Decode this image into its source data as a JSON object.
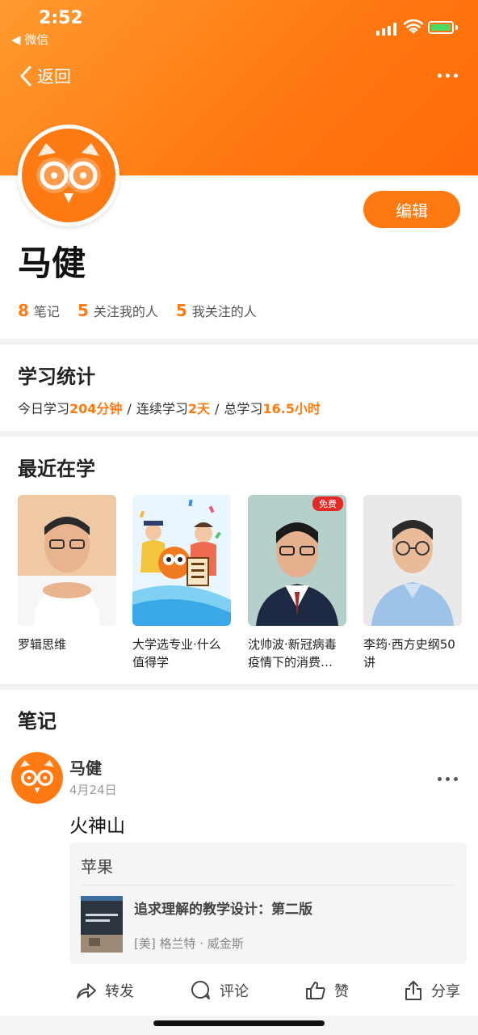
{
  "status_bar": {
    "time": "2:52",
    "back_app": "◀ 微信"
  },
  "nav": {
    "back_label": "返回"
  },
  "profile": {
    "name": "马健",
    "edit_label": "编辑",
    "stats": [
      {
        "num": "8",
        "label": "笔记"
      },
      {
        "num": "5",
        "label": "关注我的人"
      },
      {
        "num": "5",
        "label": "我关注的人"
      }
    ]
  },
  "study": {
    "title": "学习统计",
    "today_label": "今日学习",
    "today_value": "204分钟",
    "streak_label": "连续学习",
    "streak_value": "2天",
    "total_label": "总学习",
    "total_value": "16.5小时"
  },
  "recent": {
    "title": "最近在学",
    "courses": [
      {
        "title": "罗辑思维"
      },
      {
        "title": "大学选专业·什么值得学"
      },
      {
        "title": "沈帅波·新冠病毒疫情下的消费…",
        "badge": "免费"
      },
      {
        "title": "李筠·西方史纲50讲"
      }
    ]
  },
  "notes": {
    "title": "笔记",
    "items": [
      {
        "author": "马健",
        "date": "4月24日",
        "content": "火神山",
        "quote": "苹果",
        "book_title": "追求理解的教学设计：第二版",
        "book_author": "[美] 格兰特 · 威金斯",
        "actions": [
          "转发",
          "评论",
          "赞",
          "分享"
        ]
      }
    ]
  },
  "colors": {
    "accent": "#ff7a12",
    "header_start": "#ff9a30",
    "header_end": "#ff6a06"
  },
  "icons": [
    "chevron-left-icon",
    "more-icon",
    "owl-logo-icon",
    "forward-icon",
    "comment-icon",
    "like-icon",
    "share-icon"
  ]
}
